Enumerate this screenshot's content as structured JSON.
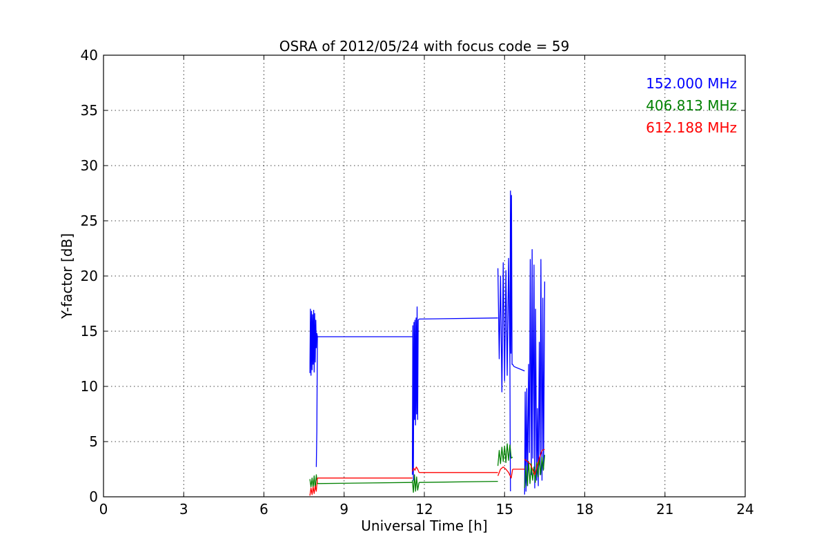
{
  "chart_data": {
    "type": "line",
    "title": "OSRA of 2012/05/24 with focus code = 59",
    "xlabel": "Universal Time [h]",
    "ylabel": "Y-factor [dB]",
    "xlim": [
      0,
      24
    ],
    "ylim": [
      0,
      40
    ],
    "xticks": [
      0,
      3,
      6,
      9,
      12,
      15,
      18,
      21,
      24
    ],
    "yticks": [
      0,
      5,
      10,
      15,
      20,
      25,
      30,
      35,
      40
    ],
    "grid": true,
    "legend_position": "top-right",
    "series": [
      {
        "name": "152.000 MHz",
        "color": "#0000ff",
        "segments": [
          {
            "x": [
              7.72,
              7.74,
              7.76,
              7.78,
              7.8,
              7.82,
              7.84,
              7.86,
              7.88,
              7.9,
              7.92,
              7.94,
              7.96,
              7.98,
              8.0
            ],
            "y": [
              11.2,
              17.0,
              11.0,
              16.8,
              11.5,
              16.5,
              12.0,
              16.9,
              11.3,
              16.6,
              12.2,
              16.0,
              13.5,
              14.8,
              14.5
            ]
          },
          {
            "x": [
              8.0,
              7.98,
              7.96
            ],
            "y": [
              14.5,
              6.0,
              2.7
            ]
          },
          {
            "x": [
              8.0,
              11.55
            ],
            "y": [
              14.5,
              14.5
            ]
          },
          {
            "x": [
              11.55,
              11.57,
              11.59,
              11.61,
              11.63,
              11.65,
              11.67,
              11.69,
              11.71,
              11.73,
              11.75,
              11.77,
              11.8
            ],
            "y": [
              2.0,
              15.5,
              1.5,
              15.8,
              7.0,
              16.0,
              6.5,
              16.2,
              7.5,
              17.2,
              7.0,
              16.0,
              16.1
            ]
          },
          {
            "x": [
              11.8,
              14.75
            ],
            "y": [
              16.1,
              16.2
            ]
          },
          {
            "x": [
              14.75,
              14.8,
              14.85,
              14.9,
              14.95,
              15.0,
              15.05,
              15.1,
              15.15,
              15.2,
              15.22,
              15.24,
              15.26,
              15.28,
              15.3,
              15.35
            ],
            "y": [
              20.7,
              12.5,
              20.0,
              9.5,
              21.2,
              10.5,
              20.5,
              11.0,
              21.6,
              12.0,
              27.7,
              13.0,
              27.3,
              12.0,
              12.0,
              11.8
            ]
          },
          {
            "x": [
              15.35,
              15.75
            ],
            "y": [
              11.8,
              11.4
            ]
          },
          {
            "x": [
              15.2,
              15.21,
              15.22
            ],
            "y": [
              12.0,
              5.0,
              0.5
            ]
          },
          {
            "x": [
              15.75,
              15.77,
              15.8,
              15.83,
              15.86,
              15.9,
              15.93,
              15.96,
              16.0,
              16.03,
              16.06,
              16.1,
              16.13,
              16.16,
              16.2,
              16.23,
              16.26,
              16.3,
              16.33,
              16.36,
              16.4,
              16.43,
              16.46,
              16.5
            ],
            "y": [
              0.2,
              9.5,
              0.5,
              9.8,
              1.0,
              12.0,
              4.0,
              21.5,
              2.0,
              22.4,
              3.5,
              21.0,
              0.8,
              17.0,
              1.5,
              8.0,
              1.0,
              14.0,
              2.0,
              21.5,
              1.5,
              18.0,
              2.5,
              19.5
            ]
          }
        ]
      },
      {
        "name": "406.813 MHz",
        "color": "#008000",
        "segments": [
          {
            "x": [
              7.72,
              7.76,
              7.8,
              7.84,
              7.88,
              7.92,
              7.96,
              8.0
            ],
            "y": [
              1.6,
              0.9,
              1.7,
              0.8,
              1.9,
              0.7,
              2.0,
              1.2
            ]
          },
          {
            "x": [
              8.0,
              11.55
            ],
            "y": [
              1.2,
              1.3
            ]
          },
          {
            "x": [
              11.55,
              11.59,
              11.63,
              11.67,
              11.71,
              11.75,
              11.8
            ],
            "y": [
              1.5,
              0.4,
              2.0,
              0.5,
              1.8,
              0.6,
              1.3
            ]
          },
          {
            "x": [
              11.8,
              14.75
            ],
            "y": [
              1.3,
              1.4
            ]
          },
          {
            "x": [
              14.75,
              14.8,
              14.85,
              14.9,
              14.95,
              15.0,
              15.05,
              15.1,
              15.15,
              15.2,
              15.25,
              15.3
            ],
            "y": [
              2.8,
              4.2,
              3.0,
              4.5,
              3.2,
              4.6,
              3.1,
              4.8,
              3.3,
              4.7,
              3.5,
              3.6
            ]
          },
          {
            "x": [
              15.75,
              15.8,
              15.85,
              15.9,
              15.95,
              16.0,
              16.05,
              16.1,
              16.15,
              16.2,
              16.25,
              16.3,
              16.35,
              16.4,
              16.45,
              16.5
            ],
            "y": [
              0.8,
              2.8,
              1.0,
              3.2,
              1.2,
              3.0,
              1.5,
              2.7,
              1.3,
              3.1,
              1.8,
              3.5,
              2.0,
              3.6,
              2.4,
              3.8
            ]
          }
        ]
      },
      {
        "name": "612.188 MHz",
        "color": "#ff0000",
        "segments": [
          {
            "x": [
              7.72,
              7.76,
              7.8,
              7.84,
              7.88,
              7.92,
              7.96,
              8.0
            ],
            "y": [
              0.1,
              0.8,
              0.2,
              0.9,
              0.3,
              1.0,
              0.5,
              1.7
            ]
          },
          {
            "x": [
              8.0,
              11.55
            ],
            "y": [
              1.7,
              1.7
            ]
          },
          {
            "x": [
              11.55,
              11.6,
              11.65,
              11.7,
              11.75,
              11.8
            ],
            "y": [
              2.3,
              2.6,
              2.4,
              2.7,
              2.5,
              2.2
            ]
          },
          {
            "x": [
              11.8,
              14.75
            ],
            "y": [
              2.2,
              2.2
            ]
          },
          {
            "x": [
              14.75,
              14.85,
              14.95,
              15.05,
              15.15,
              15.25,
              15.3
            ],
            "y": [
              1.9,
              2.5,
              2.7,
              2.5,
              2.2,
              1.7,
              2.5
            ]
          },
          {
            "x": [
              15.3,
              15.75
            ],
            "y": [
              2.5,
              2.5
            ]
          },
          {
            "x": [
              15.75,
              15.85,
              15.95,
              16.05,
              16.12,
              16.2,
              16.3,
              16.4,
              16.5
            ],
            "y": [
              3.4,
              3.2,
              3.0,
              2.5,
              2.0,
              2.6,
              3.5,
              4.2,
              4.3
            ]
          }
        ]
      }
    ]
  }
}
